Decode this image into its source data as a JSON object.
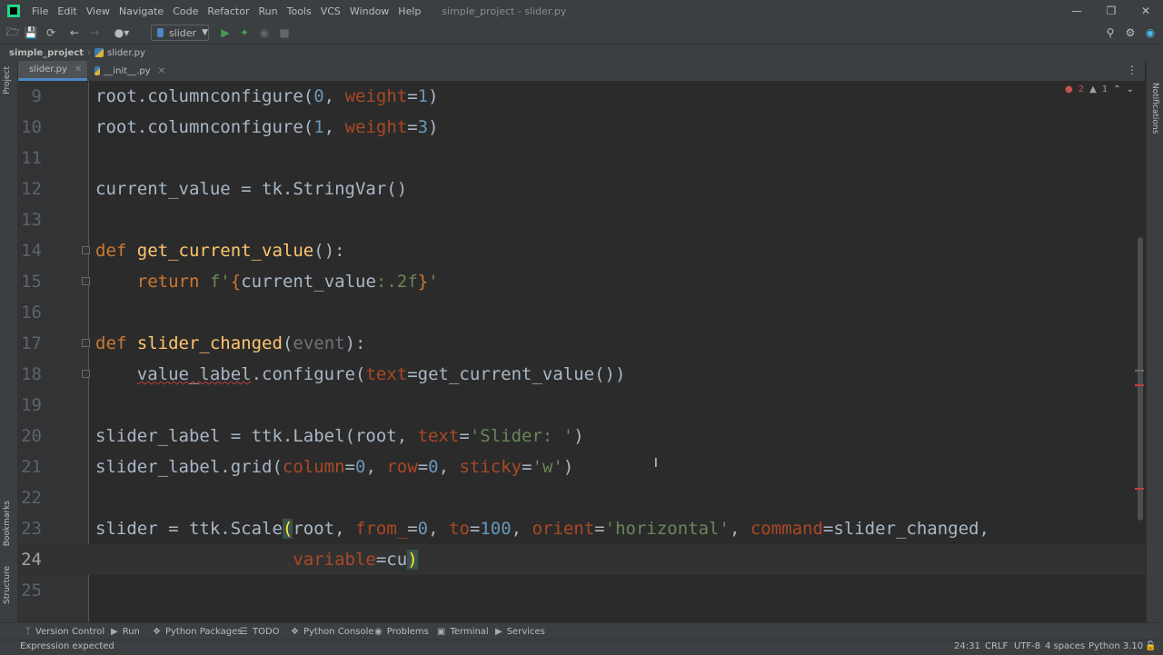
{
  "menu": [
    "File",
    "Edit",
    "View",
    "Navigate",
    "Code",
    "Refactor",
    "Run",
    "Tools",
    "VCS",
    "Window",
    "Help"
  ],
  "window_title": "simple_project - slider.py",
  "run_config": "slider",
  "breadcrumb": {
    "project": "simple_project",
    "file": "slider.py"
  },
  "tabs": [
    {
      "label": "slider.py",
      "active": true
    },
    {
      "label": "__init__.py",
      "active": false
    }
  ],
  "side_labels": {
    "project": "Project",
    "bookmarks": "Bookmarks",
    "structure": "Structure",
    "notifications": "Notifications"
  },
  "inspections": {
    "errors": "2",
    "warnings": "1"
  },
  "line_numbers": [
    "9",
    "10",
    "11",
    "12",
    "13",
    "14",
    "15",
    "16",
    "17",
    "18",
    "19",
    "20",
    "21",
    "22",
    "23",
    "24",
    "25"
  ],
  "current_line": "24",
  "bottom_tools": [
    "Version Control",
    "Run",
    "Python Packages",
    "TODO",
    "Python Console",
    "Problems",
    "Terminal",
    "Services"
  ],
  "status": {
    "message": "Expression expected",
    "position": "24:31",
    "line_sep": "CRLF",
    "encoding": "UTF-8",
    "indent": "4 spaces",
    "interpreter": "Python 3.10"
  },
  "colors": {
    "keyword": "#cc7832",
    "number": "#6897bb",
    "string": "#6a8759",
    "function": "#ffc66d",
    "param": "#aa4926",
    "background": "#2b2b2b"
  }
}
